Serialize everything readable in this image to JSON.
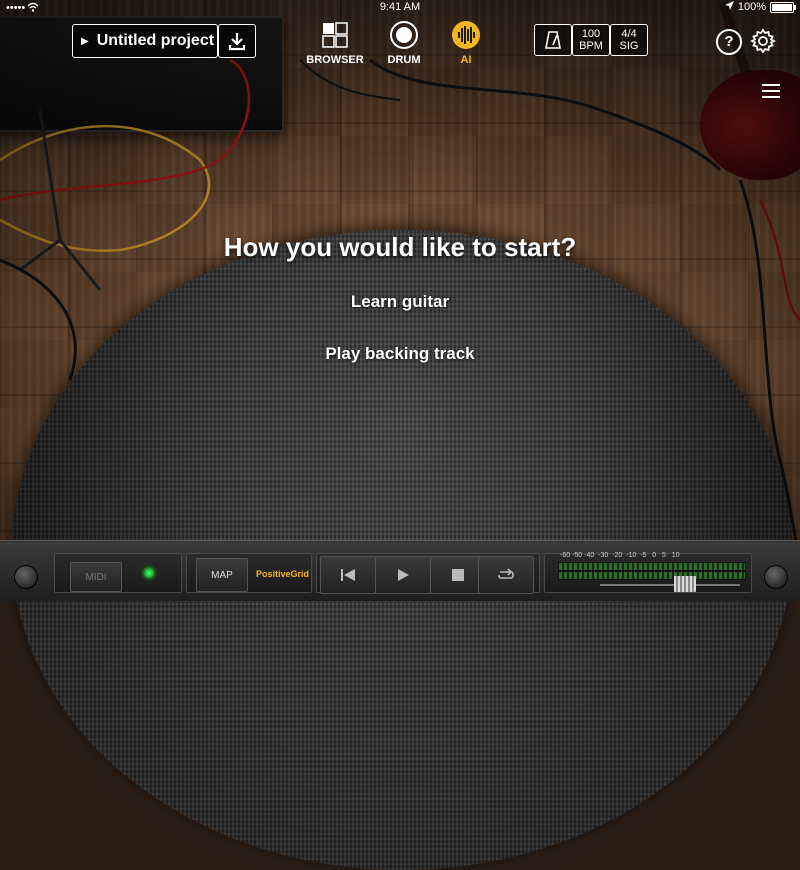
{
  "status_bar": {
    "time": "9:41 AM",
    "battery_percent": "100%"
  },
  "toolbar": {
    "project_title": "Untitled project",
    "modes": [
      {
        "label": "BROWSER",
        "icon": "grid-icon"
      },
      {
        "label": "DRUM",
        "icon": "drum-icon"
      },
      {
        "label": "AI",
        "icon": "waveform-icon",
        "active": true
      }
    ],
    "bpm_value": "100",
    "bpm_label": "BPM",
    "sig_value": "4/4",
    "sig_label": "SIG"
  },
  "prompt": {
    "title": "How you would like to start?",
    "options": [
      "Learn guitar",
      "Play backing track"
    ]
  },
  "bottom_bar": {
    "midi_label": "MIDI",
    "map_label": "MAP",
    "brand": "PositiveGrid",
    "meter_scale": [
      "-60",
      "-50",
      "-40",
      "-30",
      "-20",
      "-10",
      "-5",
      "0",
      "5",
      "10"
    ]
  },
  "colors": {
    "accent": "#f5b623",
    "midi_led": "#49ff6a"
  }
}
